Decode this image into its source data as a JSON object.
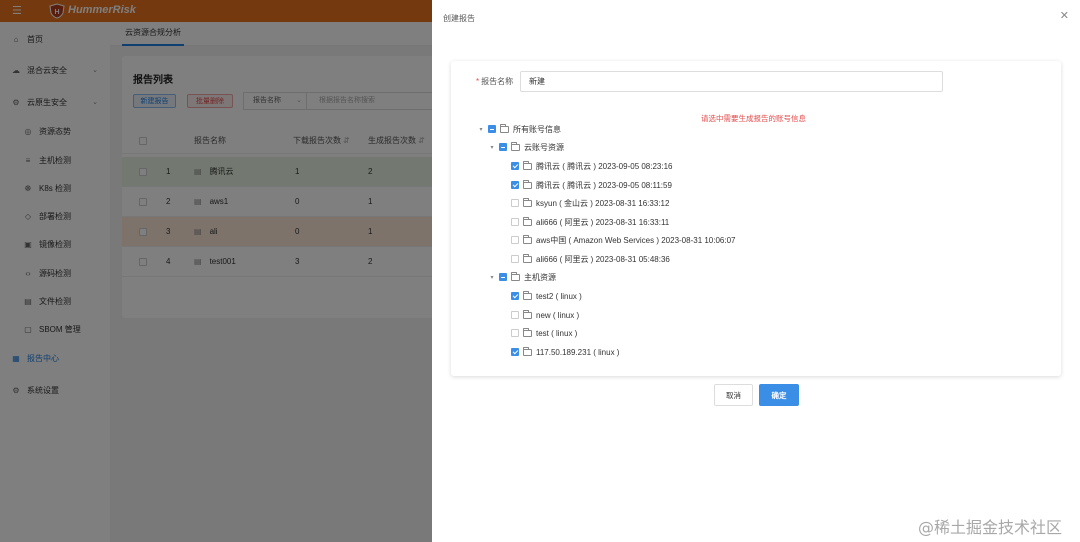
{
  "app": {
    "brand": "HummerRisk"
  },
  "sidebar": {
    "items": [
      {
        "label": "首页",
        "icon": "home-icon",
        "sub": false,
        "chevron": false,
        "active": false
      },
      {
        "label": "混合云安全",
        "icon": "cloud-icon",
        "sub": false,
        "chevron": true,
        "active": false
      },
      {
        "label": "云原生安全",
        "icon": "cloud-native-icon",
        "sub": false,
        "chevron": true,
        "active": false
      },
      {
        "label": "资源态势",
        "icon": "resource-icon",
        "sub": true,
        "chevron": false,
        "active": false
      },
      {
        "label": "主机检测",
        "icon": "host-icon",
        "sub": true,
        "chevron": false,
        "active": false
      },
      {
        "label": "K8s 检测",
        "icon": "k8s-icon",
        "sub": true,
        "chevron": false,
        "active": false
      },
      {
        "label": "部署检测",
        "icon": "deploy-icon",
        "sub": true,
        "chevron": false,
        "active": false
      },
      {
        "label": "镜像检测",
        "icon": "image-icon",
        "sub": true,
        "chevron": false,
        "active": false
      },
      {
        "label": "源码检测",
        "icon": "code-icon",
        "sub": true,
        "chevron": false,
        "active": false
      },
      {
        "label": "文件检测",
        "icon": "file-icon",
        "sub": true,
        "chevron": false,
        "active": false
      },
      {
        "label": "SBOM 管理",
        "icon": "sbom-icon",
        "sub": true,
        "chevron": false,
        "active": false
      },
      {
        "label": "报告中心",
        "icon": "report-icon",
        "sub": false,
        "chevron": false,
        "active": true
      },
      {
        "label": "系统设置",
        "icon": "settings-icon",
        "sub": false,
        "chevron": false,
        "active": false
      }
    ]
  },
  "tabs": {
    "active": "云资源合规分析"
  },
  "report_list": {
    "title": "报告列表",
    "new_button": "新建报告",
    "batch_delete_button": "批量删除",
    "filter_select": "报告名称",
    "search_placeholder": "根据报告名称搜索",
    "columns": [
      "报告名称",
      "下载报告次数",
      "生成报告次数"
    ],
    "rows": [
      {
        "index": "1",
        "name": "腾讯云",
        "downloads": "1",
        "generated": "2",
        "highlight": "green"
      },
      {
        "index": "2",
        "name": "aws1",
        "downloads": "0",
        "generated": "1",
        "highlight": ""
      },
      {
        "index": "3",
        "name": "ali",
        "downloads": "0",
        "generated": "1",
        "highlight": "orange"
      },
      {
        "index": "4",
        "name": "test001",
        "downloads": "3",
        "generated": "2",
        "highlight": ""
      }
    ]
  },
  "drawer": {
    "title": "创建报告",
    "name_label": "报告名称",
    "name_value": "新建",
    "hint": "请选中需要生成报告的账号信息",
    "tree": [
      {
        "label": "所有账号信息",
        "level": 0,
        "state": "indet",
        "caret": true
      },
      {
        "label": "云账号资源",
        "level": 1,
        "state": "indet",
        "caret": true
      },
      {
        "label": "腾讯云 ( 腾讯云 ) 2023-09-05 08:23:16",
        "level": 2,
        "state": "checked",
        "caret": false
      },
      {
        "label": "腾讯云 ( 腾讯云 ) 2023-09-05 08:11:59",
        "level": 2,
        "state": "checked",
        "caret": false
      },
      {
        "label": "ksyun ( 金山云 ) 2023-08-31 16:33:12",
        "level": 2,
        "state": "unchecked",
        "caret": false
      },
      {
        "label": "ali666 ( 阿里云 ) 2023-08-31 16:33:11",
        "level": 2,
        "state": "unchecked",
        "caret": false
      },
      {
        "label": "aws中国 ( Amazon Web Services ) 2023-08-31 10:06:07",
        "level": 2,
        "state": "unchecked",
        "caret": false
      },
      {
        "label": "ali666 ( 阿里云 ) 2023-08-31 05:48:36",
        "level": 2,
        "state": "unchecked",
        "caret": false
      },
      {
        "label": "主机资源",
        "level": 1,
        "state": "indet",
        "caret": true
      },
      {
        "label": "test2 ( linux )",
        "level": 2,
        "state": "checked",
        "caret": false
      },
      {
        "label": "new ( linux )",
        "level": 2,
        "state": "unchecked",
        "caret": false
      },
      {
        "label": "test ( linux )",
        "level": 2,
        "state": "unchecked",
        "caret": false
      },
      {
        "label": "117.50.189.231 ( linux )",
        "level": 2,
        "state": "checked",
        "caret": false
      }
    ],
    "cancel_button": "取消",
    "confirm_button": "确定"
  },
  "watermark": "@稀土掘金技术社区"
}
